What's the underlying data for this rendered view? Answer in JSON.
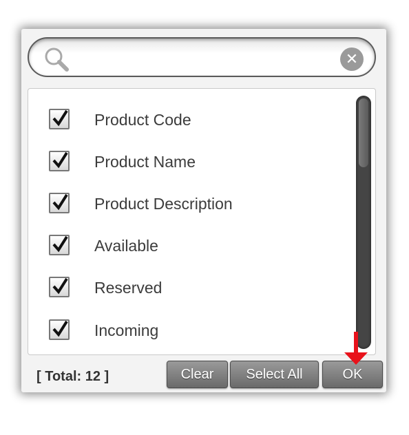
{
  "search": {
    "value": "",
    "placeholder": "",
    "search_icon": "magnifier-icon",
    "clear_icon": "clear-x-icon",
    "clear_glyph": "✕"
  },
  "list": {
    "items": [
      {
        "label": "Product Code",
        "checked": true
      },
      {
        "label": "Product Name",
        "checked": true
      },
      {
        "label": "Product Description",
        "checked": true
      },
      {
        "label": "Available",
        "checked": true
      },
      {
        "label": "Reserved",
        "checked": true
      },
      {
        "label": "Incoming",
        "checked": true
      }
    ]
  },
  "footer": {
    "total_text": "[ Total: 12 ]",
    "clear_label": "Clear",
    "select_all_label": "Select All",
    "ok_label": "OK"
  },
  "colors": {
    "arrow_annotation": "#e8121b",
    "button_gradient_top": "#9a9a9a",
    "button_gradient_bottom": "#6a6a6a",
    "scrollbar_track": "#454545"
  }
}
